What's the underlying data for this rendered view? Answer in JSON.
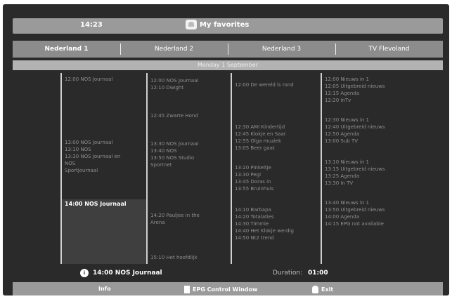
{
  "header": {
    "time": "14:23",
    "title": "My favorites"
  },
  "channels": [
    {
      "label": "Nederland 1"
    },
    {
      "label": "Nederland 2"
    },
    {
      "label": "Nederland 3"
    },
    {
      "label": "TV Flevoland"
    }
  ],
  "date": "Monday 1 September",
  "epg": {
    "col1": [
      "12:00 NOS Journaal",
      "13:00 NOS Journaal\n13:10 NOS\n13:30 NOS Journaal en\n      NOS\n      Sportjournaal",
      "14:00 NOS Journaal"
    ],
    "col2": [
      "12:00 NOS Journaal\n12:10 Dwight",
      "12:45 Zwarte Hond",
      "13:30 NOS Journaal\n13:40 NOS\n13:50 NOS Studio\n      Sportnet",
      "14:20 Pauljee in the\n      Arena",
      "15:10 Het hoofdlijk"
    ],
    "col3": [
      "12:00 De wereld is rond",
      "12:30 AMI Kindertijd\n12:45 Klokje en Saar\n12:55 Olga muziek\n13:05 Beer gaat",
      "13:20 Pinkeltje\n13:30 Pegi\n13:45 Doras in\n13:55 Bruinhuis",
      "14:10 Barbapa\n14:20 Totalaties\n14:30 Timmie\n14:40 Het Klokje werdig\n14:50 Nt2 trend"
    ],
    "col4": [
      "12:00 Nieuws in 1\n12:05 Uitgebreid nieuws\n12:15 Agenda\n12:20 InTv",
      "12:30 Nieuws in 1\n12:40 Uitgebreid nieuws\n12:50 Agenda\n13:00 Sub TV",
      "13:10 Nieuws in 1\n13:15 Uitgebreid nieuws\n13:25 Agenda\n13:30 In TV",
      "13:40 Nieuws in 1\n13:50 Uitgebreid nieuws\n14:00 Agenda\n14:15 EPG not available"
    ]
  },
  "now_playing": {
    "badge": "i",
    "label": "14:00  NOS Journaal",
    "duration_label": "Duration:",
    "duration_value": "01:00"
  },
  "footer": {
    "info": "Info",
    "epg": "EPG Control Window",
    "exit": "Exit"
  }
}
